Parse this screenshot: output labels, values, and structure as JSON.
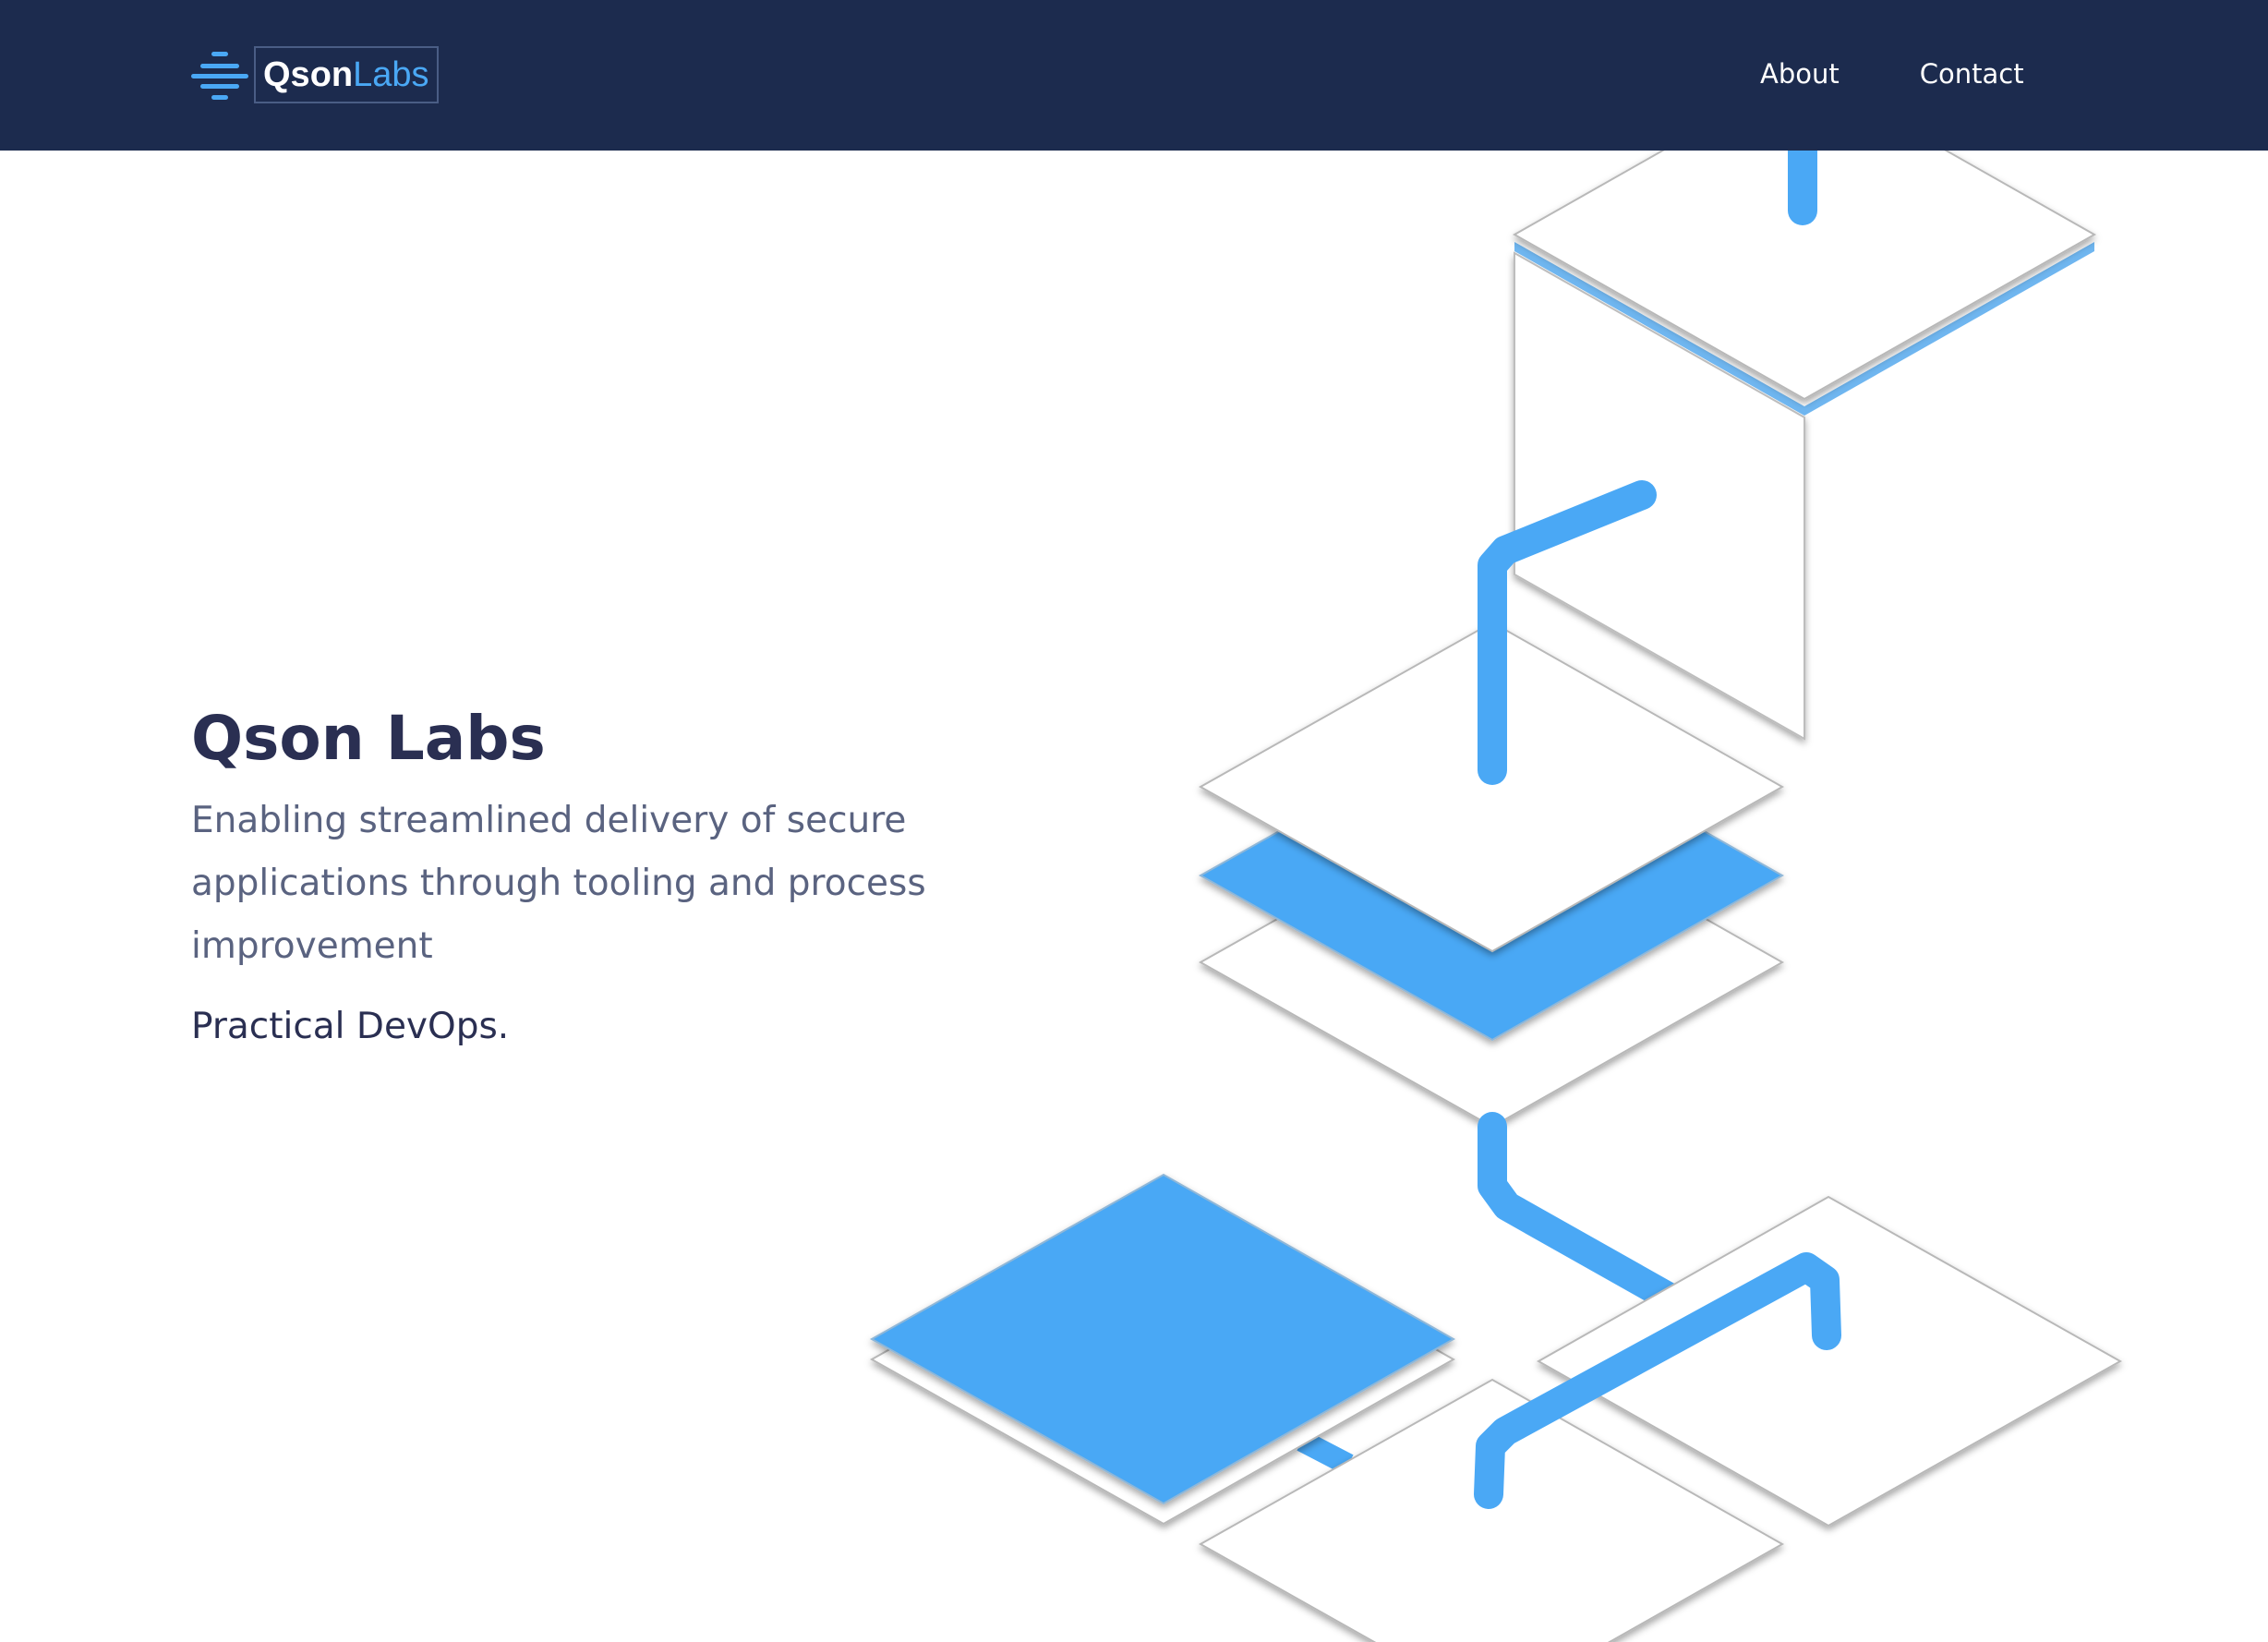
{
  "brand": {
    "name_bold": "Qson",
    "name_light": "Labs"
  },
  "nav": {
    "links": [
      "About",
      "Contact"
    ]
  },
  "hero": {
    "title": "Qson Labs",
    "subtitle": "Enabling streamlined delivery of secure applications through tooling and process improvement",
    "tagline": "Practical DevOps."
  },
  "colors": {
    "navbar": "#1c2b4e",
    "accent": "#4aa8f5",
    "title": "#2a2f52",
    "subtitle": "#5a6380"
  }
}
